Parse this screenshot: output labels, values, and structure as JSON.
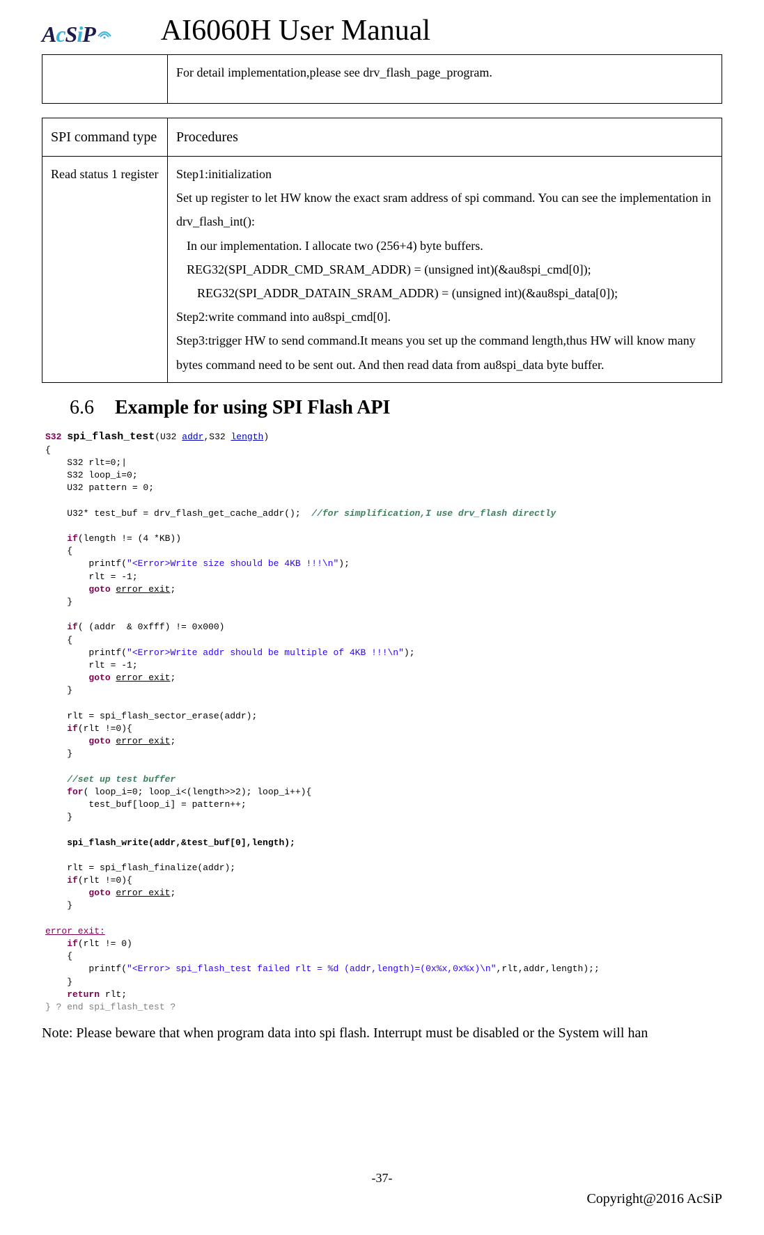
{
  "header": {
    "logo_part1": "A",
    "logo_part2": "c",
    "logo_part3": "S",
    "logo_part4": "i",
    "logo_part5": "P",
    "title": "AI6060H User Manual"
  },
  "table1": {
    "cell_right": "For detail implementation,please see drv_flash_page_program."
  },
  "table2": {
    "header_left": "SPI command type",
    "header_right": "Procedures",
    "row_left": "Read status 1 register",
    "row_right_lines": {
      "l1": "Step1:initialization",
      "l2": "Set up register to let HW know the exact sram address of spi command. You can see the implementation in drv_flash_int():",
      "l3": "In our implementation. I allocate two (256+4) byte buffers.",
      "l4": "REG32(SPI_ADDR_CMD_SRAM_ADDR) = (unsigned int)(&au8spi_cmd[0]);",
      "l5": "REG32(SPI_ADDR_DATAIN_SRAM_ADDR) = (unsigned int)(&au8spi_data[0]);",
      "l6": "Step2:write command into au8spi_cmd[0].",
      "l7": "Step3:trigger HW to send command.It means you set up the command length,thus HW will know many bytes command need to be sent out. And then read   data from au8spi_data byte buffer."
    }
  },
  "section": {
    "num": "6.6",
    "title": "Example for using SPI Flash API"
  },
  "code": {
    "l1_a": "S32 ",
    "l1_b": "spi_flash_test",
    "l1_c": "(U32 ",
    "l1_d": "addr",
    "l1_e": ",S32 ",
    "l1_f": "length",
    "l1_g": ")",
    "l2": "{",
    "l3": "    S32 rlt=0;|",
    "l4": "    S32 loop_i=0;",
    "l5": "    U32 pattern = 0;",
    "l6": "",
    "l7_a": "    U32* test_buf = drv_flash_get_cache_addr();  ",
    "l7_b": "//for simplification,I use drv_flash directly",
    "l8": "",
    "l9_a": "    if",
    "l9_b": "(length != (4 *KB))",
    "l10": "    {",
    "l11_a": "        printf(",
    "l11_b": "\"<Error>Write size should be 4KB !!!\\n\"",
    "l11_c": ");",
    "l12": "        rlt = -1;",
    "l13_a": "        goto ",
    "l13_b": "error_exit",
    "l13_c": ";",
    "l14": "    }",
    "l15": "",
    "l16_a": "    if",
    "l16_b": "( (addr  & 0xfff) != 0x000)",
    "l17": "    {",
    "l18_a": "        printf(",
    "l18_b": "\"<Error>Write addr should be multiple of 4KB !!!\\n\"",
    "l18_c": ");",
    "l19": "        rlt = -1;",
    "l20_a": "        goto ",
    "l20_b": "error_exit",
    "l20_c": ";",
    "l21": "    }",
    "l22": "",
    "l23": "    rlt = spi_flash_sector_erase(addr);",
    "l24_a": "    if",
    "l24_b": "(rlt !=0){",
    "l25_a": "        goto ",
    "l25_b": "error_exit",
    "l25_c": ";",
    "l26": "    }",
    "l27": "",
    "l28": "    //set up test buffer",
    "l29_a": "    for",
    "l29_b": "( loop_i=0; loop_i<(length>>2); loop_i++){",
    "l30": "        test_buf[loop_i] = pattern++;",
    "l31": "    }",
    "l32": "",
    "l33": "    spi_flash_write(addr,&test_buf[0],length);",
    "l34": "",
    "l35": "    rlt = spi_flash_finalize(addr);",
    "l36_a": "    if",
    "l36_b": "(rlt !=0){",
    "l37_a": "        goto ",
    "l37_b": "error_exit",
    "l37_c": ";",
    "l38": "    }",
    "l39": "",
    "l40": "error_exit:",
    "l41_a": "    if",
    "l41_b": "(rlt != 0)",
    "l42": "    {",
    "l43_a": "        printf(",
    "l43_b": "\"<Error> spi_flash_test failed rlt = %d (addr,length)=(0x%x,0x%x)\\n\"",
    "l43_c": ",rlt,addr,length);;",
    "l44": "    }",
    "l45_a": "    return",
    "l45_b": " rlt;",
    "l46": "} ? end spi_flash_test ?"
  },
  "note": "Note: Please beware that when program data into spi flash. Interrupt must be disabled or the System will han",
  "footer": {
    "page": "-37-",
    "copyright": "Copyright@2016  AcSiP"
  }
}
